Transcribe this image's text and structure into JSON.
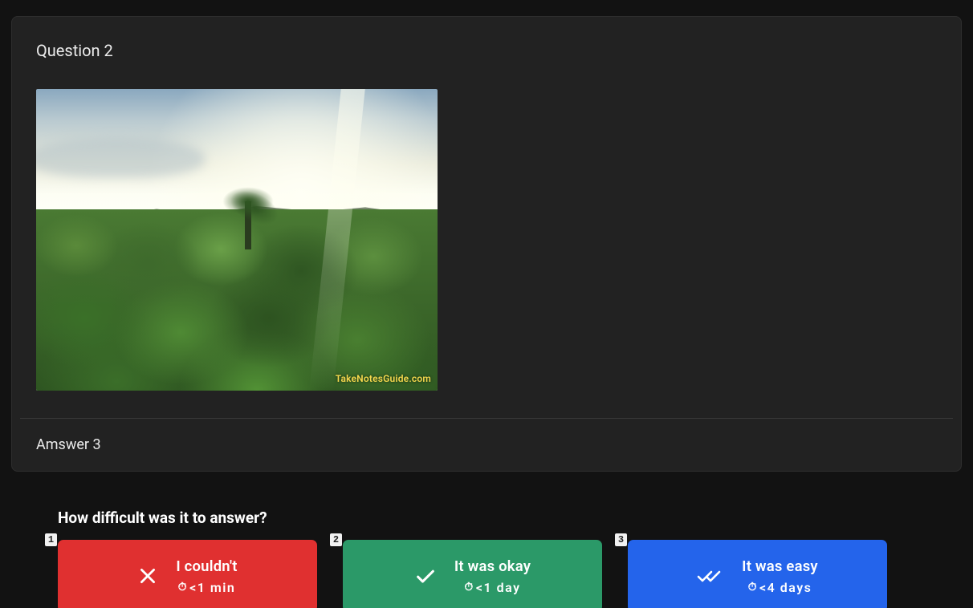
{
  "card": {
    "question_title": "Question 2",
    "image_watermark": "TakeNotesGuide.com",
    "answer_text": "Amswer 3"
  },
  "footer": {
    "prompt": "How difficult was it to answer?",
    "buttons": [
      {
        "key": "1",
        "label": "I couldn't",
        "time": "<1 min",
        "clock": "⏱"
      },
      {
        "key": "2",
        "label": "It was okay",
        "time": "<1 day",
        "clock": "⏱"
      },
      {
        "key": "3",
        "label": "It was easy",
        "time": "<4 days",
        "clock": "⏱"
      }
    ]
  }
}
